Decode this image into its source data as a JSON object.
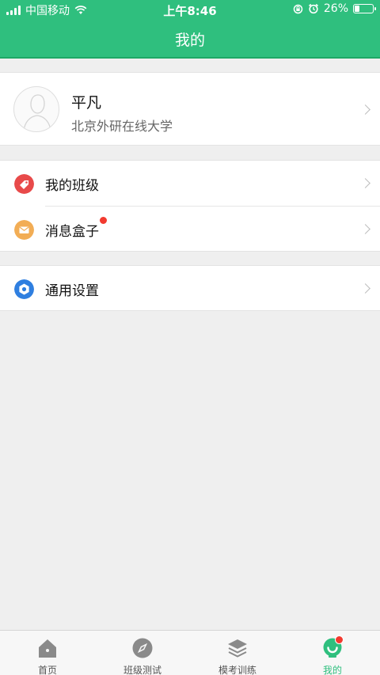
{
  "status_bar": {
    "carrier": "中国移动",
    "time": "上午8:46",
    "battery": "26%",
    "battery_level": 0.26
  },
  "header": {
    "title": "我的"
  },
  "profile": {
    "name": "平凡",
    "organization": "北京外研在线大学"
  },
  "menu": {
    "my_class": "我的班级",
    "message_box": "消息盒子",
    "settings": "通用设置"
  },
  "tabs": [
    {
      "label": "首页",
      "icon": "home-icon"
    },
    {
      "label": "班级测试",
      "icon": "compass-icon"
    },
    {
      "label": "模考训练",
      "icon": "layers-icon"
    },
    {
      "label": "我的",
      "icon": "profile-icon",
      "active": true
    }
  ],
  "colors": {
    "brand_green": "#2fbf7e",
    "badge_red": "#f23a2f",
    "class_icon_red": "#e84a4a",
    "message_icon_orange": "#f2ad55",
    "settings_icon_blue": "#2f7fe0"
  }
}
